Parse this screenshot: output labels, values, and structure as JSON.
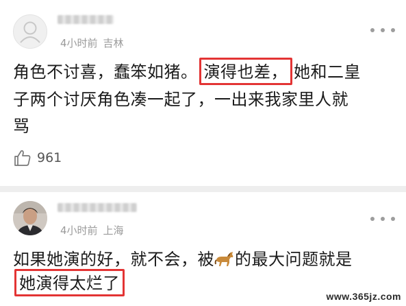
{
  "comments": [
    {
      "meta": {
        "time": "4小时前",
        "location": "吉林"
      },
      "lines": {
        "l1_before": "角色不讨喜，蠢笨如猪。",
        "l1_highlight": "演得也差，",
        "l1_after": "她和二皇",
        "l2": "子两个讨厌角色凑一起了，一出来我家里人就",
        "l3": "骂"
      },
      "likes": "961",
      "icons": {
        "like": "thumbs-up-icon",
        "more": "more-dots-icon",
        "avatar": "default-avatar-icon"
      }
    },
    {
      "meta": {
        "time": "4小时前",
        "location": "上海"
      },
      "lines": {
        "l1_before": "如果她演的好，就不会，被",
        "l1_after": "的最大问题就是",
        "l2_highlight": "她演得太烂了"
      },
      "icons": {
        "horse": "horse-emoji-icon",
        "more": "more-dots-icon",
        "avatar": "user-avatar-photo"
      }
    }
  ],
  "watermark": "www.365jz.com",
  "colors": {
    "highlight_border": "#e33434",
    "meta_text": "#9a9a9a",
    "separator": "#eeeeee"
  }
}
